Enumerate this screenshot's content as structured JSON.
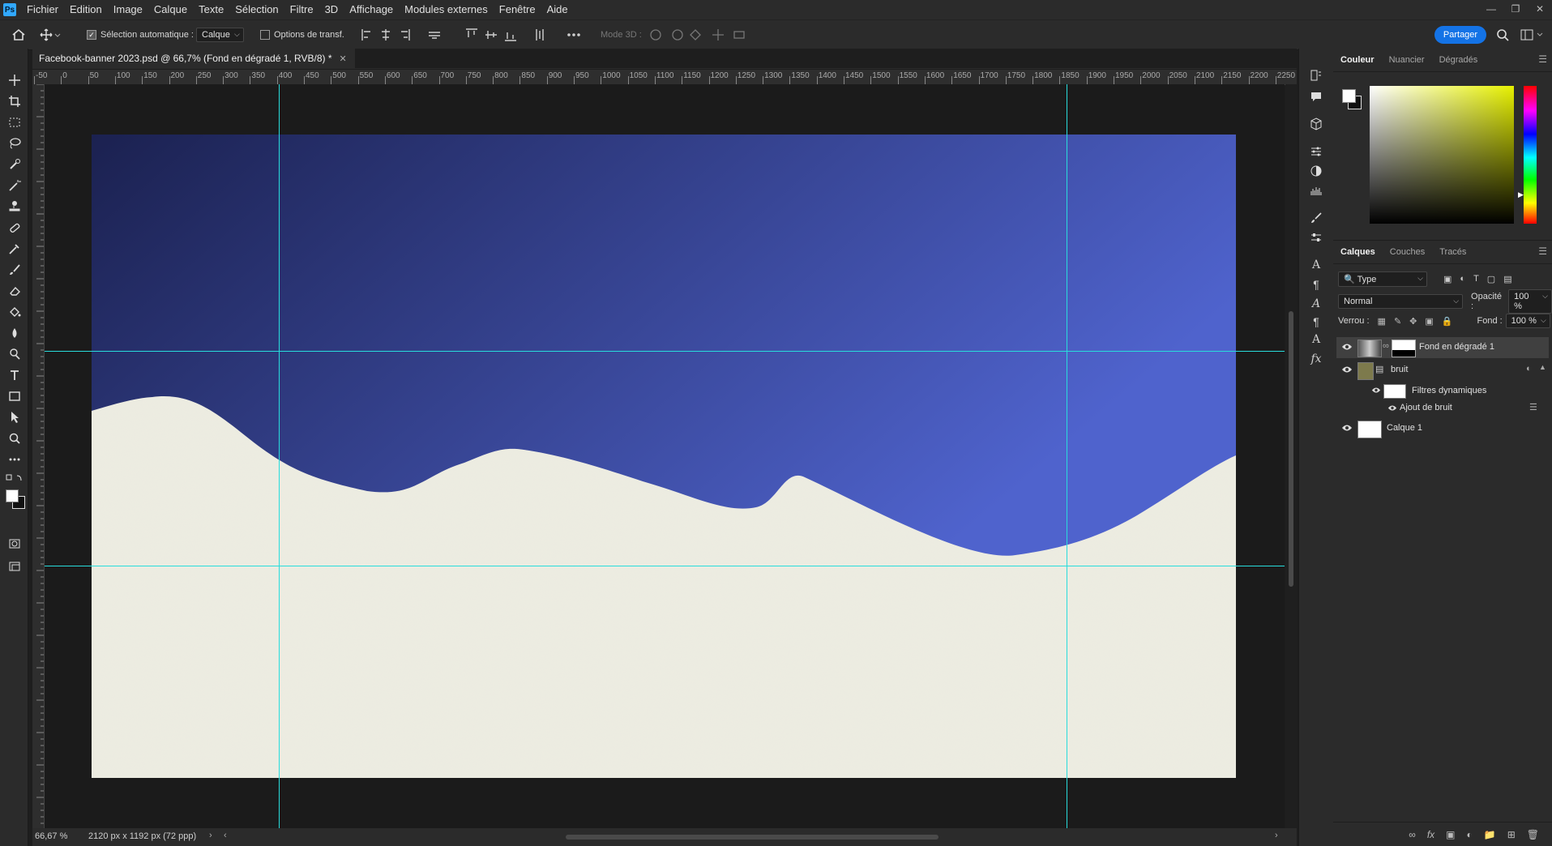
{
  "app": {
    "logo": "Ps",
    "accent": "#31a8ff"
  },
  "menu": [
    "Fichier",
    "Edition",
    "Image",
    "Calque",
    "Texte",
    "Sélection",
    "Filtre",
    "3D",
    "Affichage",
    "Modules externes",
    "Fenêtre",
    "Aide"
  ],
  "options": {
    "auto_select_label": "Sélection automatique :",
    "auto_select_checked": true,
    "auto_select_target": "Calque",
    "transform_label": "Options de transf.",
    "transform_checked": false,
    "mode3d_label": "Mode 3D :",
    "share_label": "Partager",
    "share_color": "#1473e6"
  },
  "document": {
    "tab_title": "Facebook-banner 2023.psd @ 66,7% (Fond en dégradé 1, RVB/8) *",
    "zoom": "66,67 %",
    "size": "2120 px x 1192 px (72 ppp)",
    "gradient_dark": "#1b2150",
    "gradient_light": "#4f63cd",
    "snow_color": "#edece1",
    "guide_color": "#28dcdc"
  },
  "ruler_h": [
    "-50",
    "0",
    "50",
    "100",
    "150",
    "200",
    "250",
    "300",
    "350",
    "400",
    "450",
    "500",
    "550",
    "600",
    "650",
    "700",
    "750",
    "800",
    "850",
    "900",
    "950",
    "1000",
    "1050",
    "1100",
    "1150",
    "1200",
    "1250",
    "1300",
    "1350",
    "1400",
    "1450",
    "1500",
    "1550",
    "1600",
    "1650",
    "1700",
    "1750",
    "1800",
    "1850",
    "1900",
    "1950",
    "2000",
    "2050",
    "2100",
    "2150",
    "2200",
    "2250"
  ],
  "panels": {
    "color_tabs": [
      "Couleur",
      "Nuancier",
      "Dégradés"
    ],
    "layers_tabs": [
      "Calques",
      "Couches",
      "Tracés"
    ],
    "filter_label": "Type",
    "blend_mode": "Normal",
    "opacity_label": "Opacité :",
    "opacity_value": "100 %",
    "lock_label": "Verrou :",
    "fill_label": "Fond :",
    "fill_value": "100 %",
    "layers": [
      {
        "name": "Fond en dégradé 1"
      },
      {
        "name": "bruit"
      },
      {
        "name": "Filtres dynamiques"
      },
      {
        "name": "Ajout de bruit"
      },
      {
        "name": "Calque 1"
      }
    ]
  },
  "icons": [
    "ps-logo",
    "home-icon",
    "move-icon",
    "crop-icon",
    "marquee-icon",
    "lasso-icon",
    "pen-icon",
    "brush-icon",
    "eraser-icon",
    "bucket-icon",
    "text-icon",
    "rectangle-icon",
    "zoom-icon",
    "search-icon",
    "eye-icon",
    "fx-icon",
    "trash-icon"
  ]
}
